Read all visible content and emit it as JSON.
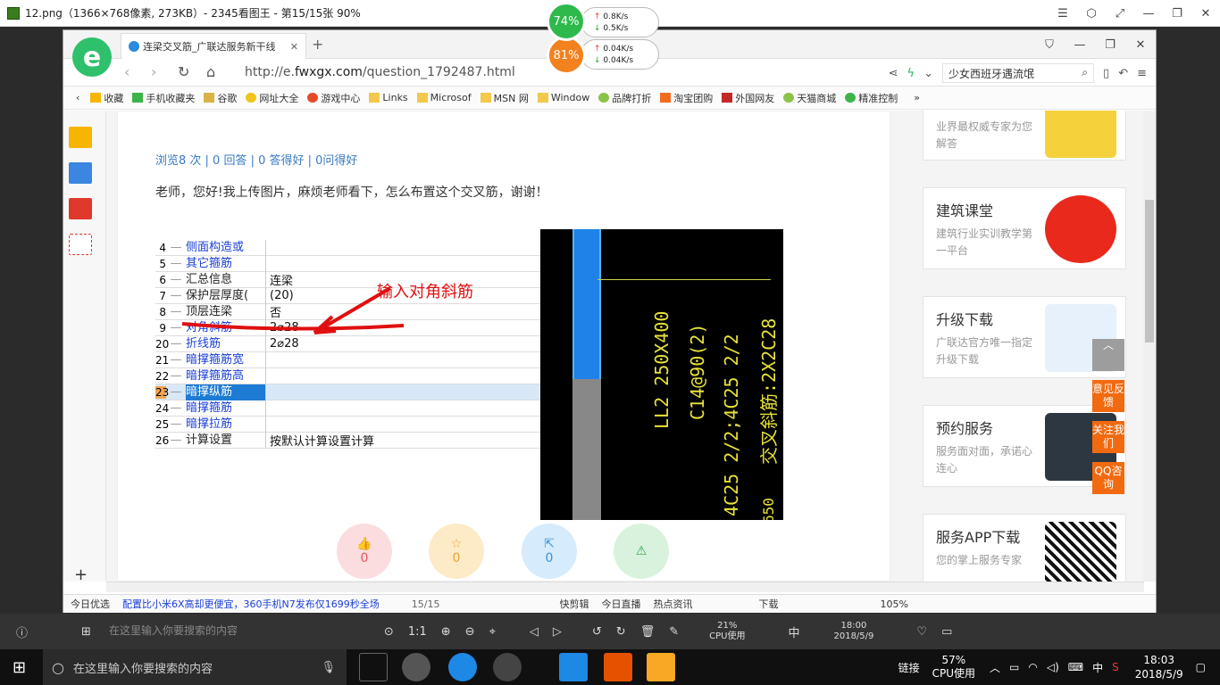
{
  "viewer": {
    "title": "12.png（1366×768像素, 273KB）- 2345看图王 - 第15/15张 90%",
    "page_counter": "15/15",
    "taskbar_search_placeholder": "在这里输入你要搜索的内容",
    "ratio_label": "1:1",
    "cpu_percent": "21%",
    "cpu_label": "CPU使用",
    "ime": "中",
    "time": "18:00",
    "date": "2018/5/9"
  },
  "net_widget": {
    "cpu1": "74%",
    "up1": "0.8K/s",
    "down1": "0.5K/s",
    "cpu2": "81%",
    "up2": "0.04K/s",
    "down2": "0.04K/s"
  },
  "browser": {
    "tab_title": "连梁交叉筋_广联达服务新干线",
    "url_prefix": "http://e.",
    "url_domain": "fwxgx.com",
    "url_path": "/question_1792487.html",
    "search_text": "少女西班牙遇流氓",
    "favorites": [
      "收藏",
      "手机收藏夹",
      "谷歌",
      "网址大全",
      "游戏中心",
      "Links",
      "Microsof",
      "MSN 网",
      "Window",
      "品牌打折",
      "淘宝团购",
      "外国网友",
      "天猫商城",
      "精准控制"
    ],
    "status_items": [
      "今日优选",
      "配置比小米6X高却更便宜，360手机N7发布仅1699秒全场",
      "快剪辑",
      "今日直播",
      "热点资讯",
      "下载",
      "105%"
    ]
  },
  "question": {
    "stats": "浏览8 次 | 0 回答 | 0 答得好 | 0问得好",
    "text": "老师，您好!我上传图片，麻烦老师看下，怎么布置这个交叉筋，谢谢！",
    "grid_rows": [
      {
        "n": "4",
        "k": "侧面构造或",
        "v": "",
        "blue": true
      },
      {
        "n": "5",
        "k": "其它箍筋",
        "v": "",
        "blue": true
      },
      {
        "n": "6",
        "k": "汇总信息",
        "v": "连梁",
        "blue": false
      },
      {
        "n": "7",
        "k": "保护层厚度(",
        "v": "(20)",
        "blue": false
      },
      {
        "n": "8",
        "k": "顶层连梁",
        "v": "否",
        "blue": false
      },
      {
        "n": "9",
        "k": "对角斜筋",
        "v": "2⌀28",
        "blue": true
      },
      {
        "n": "20",
        "k": "折线筋",
        "v": "2⌀28",
        "blue": true
      },
      {
        "n": "21",
        "k": "暗撑箍筋宽",
        "v": "",
        "blue": true
      },
      {
        "n": "22",
        "k": "暗撑箍筋高",
        "v": "",
        "blue": true
      },
      {
        "n": "23",
        "k": "暗撑纵筋",
        "v": "",
        "blue": true,
        "selected": true
      },
      {
        "n": "24",
        "k": "暗撑箍筋",
        "v": "",
        "blue": true
      },
      {
        "n": "25",
        "k": "暗撑拉筋",
        "v": "",
        "blue": true
      },
      {
        "n": "26",
        "k": "计算设置",
        "v": "按默认计算设置计算",
        "blue": false
      }
    ],
    "annotation": "输入对角斜筋",
    "cad_text": [
      "LL2 250X400",
      "C14@90(2)",
      "4C25 2/2;4C25 2/2",
      "交叉斜筋:2X2C28",
      "650"
    ],
    "actions": [
      {
        "label": "0",
        "icon": "thumbs-up-icon"
      },
      {
        "label": "0",
        "icon": "star-icon"
      },
      {
        "label": "0",
        "icon": "share-icon"
      },
      {
        "label": "",
        "icon": "warning-icon"
      }
    ]
  },
  "sidebar": {
    "cards": [
      {
        "title": "",
        "sub": "业界最权威专家为您解答"
      },
      {
        "title": "建筑课堂",
        "sub": "建筑行业实训教学第一平台"
      },
      {
        "title": "升级下载",
        "sub": "广联达官方唯一指定升级下载"
      },
      {
        "title": "预约服务",
        "sub": "服务面对面，承诺心连心"
      },
      {
        "title": "服务APP下载",
        "sub": "您的掌上服务专家"
      }
    ],
    "float_buttons": [
      "意见反馈",
      "关注我们",
      "QQ咨询"
    ]
  },
  "taskbar": {
    "search_placeholder": "在这里输入你要搜索的内容",
    "links_label": "链接",
    "cpu_percent": "57%",
    "cpu_label": "CPU使用",
    "ime": "中",
    "time": "18:03",
    "date": "2018/5/9"
  },
  "colors": {
    "accent_blue": "#1e7bd4",
    "link_blue": "#3a7ac0",
    "annotation_red": "#e01010",
    "float_orange": "#f26a10"
  }
}
